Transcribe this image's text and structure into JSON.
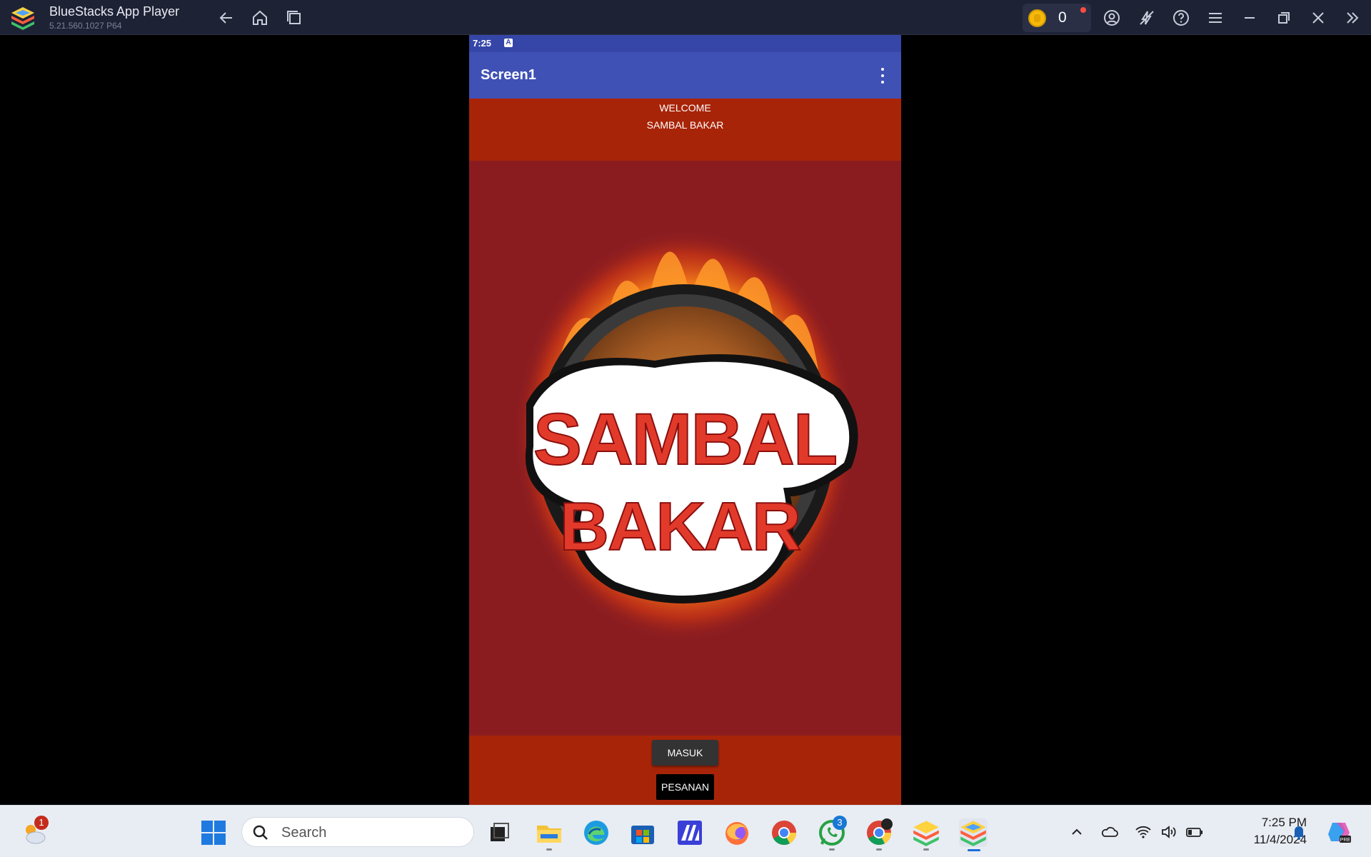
{
  "titlebar": {
    "app_name": "BlueStacks App Player",
    "version": "5.21.560.1027  P64",
    "coin_count": "0",
    "icons": [
      "back-icon",
      "home-icon",
      "recent-apps-icon",
      "user-icon",
      "eco-mode-icon",
      "help-icon",
      "menu-icon",
      "minimize-icon",
      "restore-icon",
      "close-icon",
      "collapse-sidebar-icon"
    ]
  },
  "android": {
    "status_time": "7:25",
    "status_icon_label": "A",
    "app_bar_title": "Screen1",
    "welcome_line1": "WELCOME",
    "welcome_line2": "SAMBAL BAKAR",
    "logo_text_1": "SAMBAL",
    "logo_text_2": "BAKAR",
    "button_masuk": "MASUK",
    "button_pesanan": "PESANAN",
    "colors": {
      "status_bar": "#3546a8",
      "app_bar": "#3f51b5",
      "header_bg": "#a82408",
      "content_bg": "#8a1c20"
    }
  },
  "taskbar": {
    "weather_badge": "1",
    "search_placeholder": "Search",
    "whatsapp_badge": "3",
    "clock_time": "7:25 PM",
    "clock_date": "11/4/2024",
    "apps": [
      "weather-icon",
      "start-icon",
      "task-view-icon",
      "file-explorer-icon",
      "edge-icon",
      "ms-store-icon",
      "app-icon",
      "firefox-icon",
      "chrome-icon",
      "whatsapp-icon",
      "chrome-profile-icon",
      "bluestacks-icon",
      "bluestacks-active-icon"
    ]
  }
}
